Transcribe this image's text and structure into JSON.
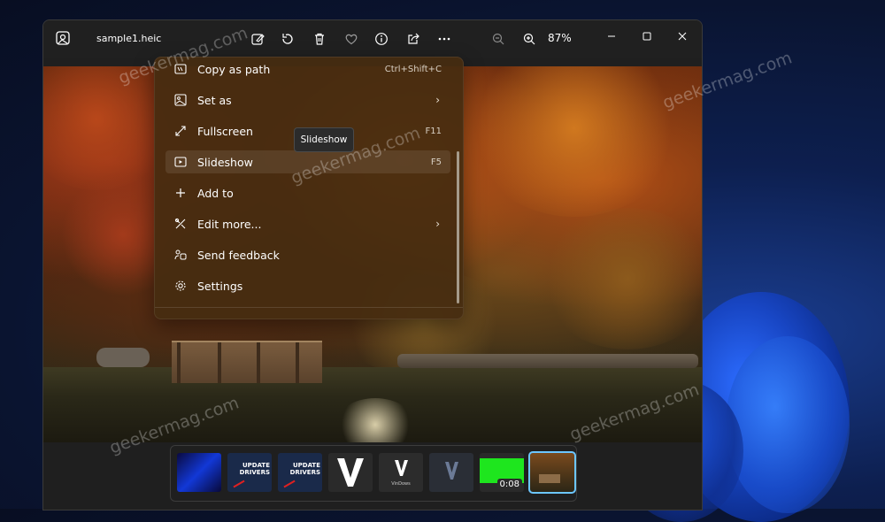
{
  "window": {
    "file_name": "sample1.heic",
    "zoom": "87%"
  },
  "toolbar": [
    {
      "name": "edit-image-icon"
    },
    {
      "name": "rotate-icon"
    },
    {
      "name": "delete-icon"
    },
    {
      "name": "favorite-icon"
    },
    {
      "name": "info-icon"
    },
    {
      "name": "share-icon"
    },
    {
      "name": "more-icon"
    }
  ],
  "context_menu": {
    "items": [
      {
        "label": "Copy as path",
        "shortcut": "Ctrl+Shift+C",
        "icon": "copy-path-icon"
      },
      {
        "label": "Set as",
        "shortcut": "",
        "icon": "set-as-icon",
        "submenu": true
      },
      {
        "label": "Fullscreen",
        "shortcut": "F11",
        "icon": "fullscreen-icon"
      },
      {
        "label": "Slideshow",
        "shortcut": "F5",
        "icon": "slideshow-icon",
        "active": true
      },
      {
        "label": "Add to",
        "shortcut": "",
        "icon": "plus-icon"
      },
      {
        "label": "Edit more...",
        "shortcut": "",
        "icon": "edit-more-icon",
        "submenu": true
      },
      {
        "label": "Send feedback",
        "shortcut": "",
        "icon": "feedback-icon"
      },
      {
        "label": "Settings",
        "shortcut": "",
        "icon": "gear-icon"
      }
    ]
  },
  "tooltip": "Slideshow",
  "filmstrip": {
    "thumbnails": [
      {
        "kind": "blue-photo"
      },
      {
        "kind": "update-drivers",
        "text": "UPDATE DRIVERS"
      },
      {
        "kind": "update-drivers",
        "text": "UPDATE DRIVERS"
      },
      {
        "kind": "v-logo"
      },
      {
        "kind": "v-logo-small",
        "text": "VinDows"
      },
      {
        "kind": "v-logo-dark"
      },
      {
        "kind": "green-video",
        "duration": "0:08"
      },
      {
        "kind": "autumn-photo",
        "selected": true
      }
    ]
  },
  "watermark": "geekermag.com"
}
